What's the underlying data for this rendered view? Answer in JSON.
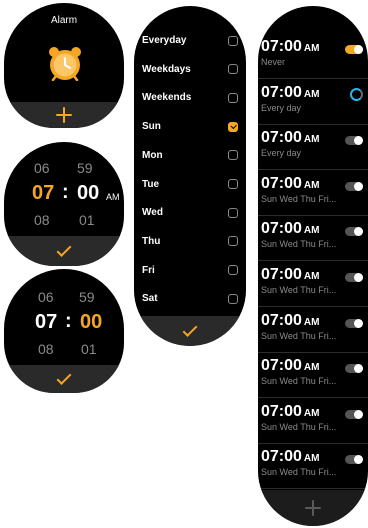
{
  "alarm_home": {
    "title": "Alarm"
  },
  "time_picker_1": {
    "prev_hour": "06",
    "prev_min": "59",
    "hour": "07",
    "colon": ":",
    "min": "00",
    "ampm": "AM",
    "next_hour": "08",
    "next_min": "01"
  },
  "time_picker_2": {
    "prev_hour": "06",
    "prev_min": "59",
    "hour": "07",
    "colon": ":",
    "min": "00",
    "next_hour": "08",
    "next_min": "01"
  },
  "repeat": {
    "options": [
      {
        "label": "Everyday",
        "checked": false
      },
      {
        "label": "Weekdays",
        "checked": false
      },
      {
        "label": "Weekends",
        "checked": false
      },
      {
        "label": "Sun",
        "checked": true
      },
      {
        "label": "Mon",
        "checked": false
      },
      {
        "label": "Tue",
        "checked": false
      },
      {
        "label": "Wed",
        "checked": false
      },
      {
        "label": "Thu",
        "checked": false
      },
      {
        "label": "Fri",
        "checked": false
      },
      {
        "label": "Sat",
        "checked": false
      }
    ]
  },
  "alarm_list": {
    "items": [
      {
        "time": "07:00",
        "ampm": "AM",
        "sub": "Never",
        "state": "on"
      },
      {
        "time": "07:00",
        "ampm": "AM",
        "sub": "Every day",
        "state": "loading"
      },
      {
        "time": "07:00",
        "ampm": "AM",
        "sub": "Every day",
        "state": "off"
      },
      {
        "time": "07:00",
        "ampm": "AM",
        "sub": "Sun  Wed  Thu  Fri...",
        "state": "off"
      },
      {
        "time": "07:00",
        "ampm": "AM",
        "sub": "Sun  Wed  Thu  Fri...",
        "state": "off"
      },
      {
        "time": "07:00",
        "ampm": "AM",
        "sub": "Sun  Wed  Thu  Fri...",
        "state": "off"
      },
      {
        "time": "07:00",
        "ampm": "AM",
        "sub": "Sun  Wed  Thu  Fri...",
        "state": "off"
      },
      {
        "time": "07:00",
        "ampm": "AM",
        "sub": "Sun  Wed  Thu  Fri...",
        "state": "off"
      },
      {
        "time": "07:00",
        "ampm": "AM",
        "sub": "Sun  Wed  Thu  Fri...",
        "state": "off"
      },
      {
        "time": "07:00",
        "ampm": "AM",
        "sub": "Sun  Wed  Thu  Fri...",
        "state": "off"
      }
    ]
  },
  "colors": {
    "accent": "#f5a623",
    "footer": "#2a2a2a",
    "dim_text": "#8a8a8a",
    "loading": "#29b6e8"
  },
  "icons": {
    "alarm": "alarm-clock-icon",
    "add": "plus-icon",
    "confirm": "checkmark-icon"
  }
}
